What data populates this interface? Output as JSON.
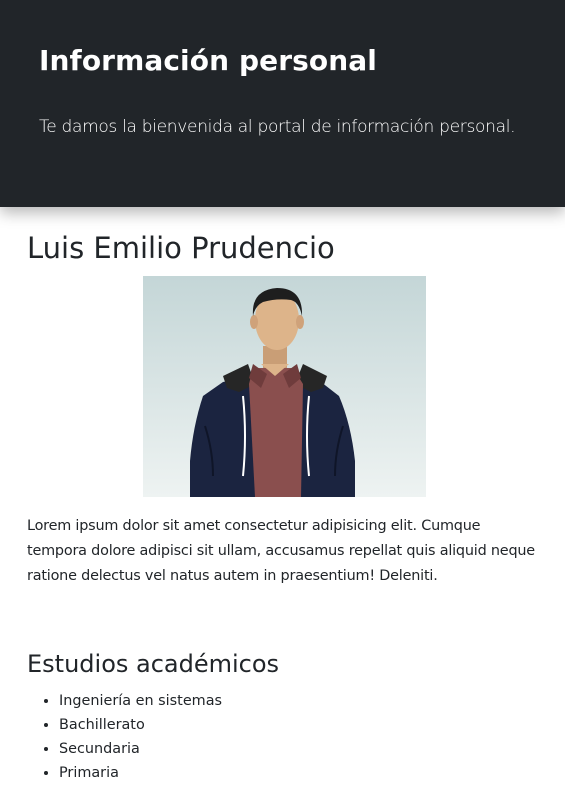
{
  "header": {
    "title": "Información personal",
    "lead": "Te damos la bienvenida al portal de información personal."
  },
  "profile": {
    "name": "Luis Emilio Prudencio",
    "photo_icon": "person-portrait-illustration",
    "bio": "Lorem ipsum dolor sit amet consectetur adipisicing elit. Cumque tempora dolore adipisci sit ullam, accusamus repellat quis aliquid neque ratione delectus vel natus autem in praesentium! Deleniti."
  },
  "studies": {
    "title": "Estudios académicos",
    "items": [
      "Ingeniería en sistemas",
      "Bachillerato",
      "Secundaria",
      "Primaria"
    ]
  },
  "colors": {
    "header_bg": "#212529",
    "header_text": "#ffffff",
    "body_text": "#212529",
    "jacket": "#1b2440",
    "shirt": "#8a4f4e",
    "skin": "#ddb48a",
    "hair": "#1e1e1e",
    "photo_bg_top": "#c4d6d7",
    "photo_bg_bottom": "#eef3f2"
  }
}
